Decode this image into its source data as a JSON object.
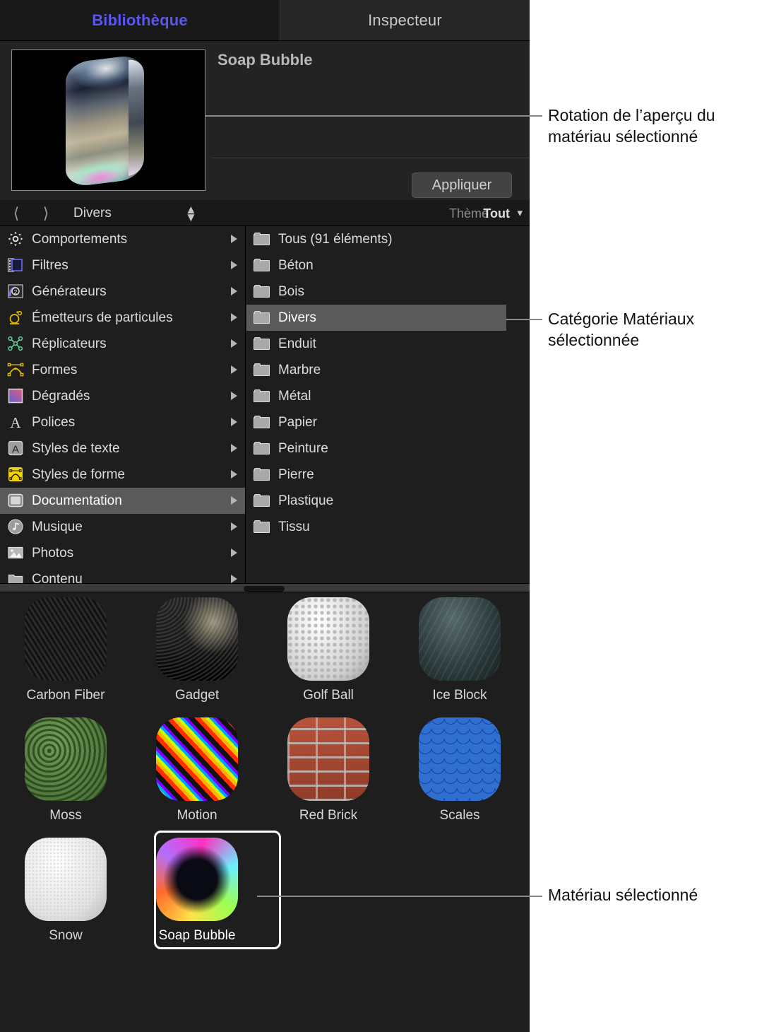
{
  "tabs": [
    {
      "label": "Bibliothèque",
      "active": true
    },
    {
      "label": "Inspecteur",
      "active": false
    }
  ],
  "preview": {
    "title": "Soap Bubble",
    "apply_label": "Appliquer"
  },
  "navbar": {
    "back_icon": "chevron-left-icon",
    "forward_icon": "chevron-right-icon",
    "path": "Divers",
    "sort_up": "▲",
    "sort_down": "▼",
    "theme_label": "Thème :",
    "theme_value": "Tout",
    "theme_caret": "⌄"
  },
  "sidebar": {
    "items": [
      {
        "label": "Comportements",
        "icon": "gear-icon",
        "selected": false
      },
      {
        "label": "Filtres",
        "icon": "filmstrip-icon",
        "selected": false
      },
      {
        "label": "Générateurs",
        "icon": "generator-icon",
        "selected": false
      },
      {
        "label": "Émetteurs de particules",
        "icon": "particle-emitter-icon",
        "selected": false
      },
      {
        "label": "Réplicateurs",
        "icon": "replicator-icon",
        "selected": false
      },
      {
        "label": "Formes",
        "icon": "shape-icon",
        "selected": false
      },
      {
        "label": "Dégradés",
        "icon": "gradient-icon",
        "selected": false
      },
      {
        "label": "Polices",
        "icon": "font-icon",
        "selected": false
      },
      {
        "label": "Styles de texte",
        "icon": "text-style-icon",
        "selected": false
      },
      {
        "label": "Styles de forme",
        "icon": "shape-style-icon",
        "selected": false
      },
      {
        "label": "Documentation",
        "icon": "documentation-icon",
        "selected": true
      },
      {
        "label": "Musique",
        "icon": "music-icon",
        "selected": false
      },
      {
        "label": "Photos",
        "icon": "photos-icon",
        "selected": false
      },
      {
        "label": "Contenu",
        "icon": "folder-icon",
        "selected": false
      }
    ]
  },
  "categories": {
    "items": [
      {
        "label": "Tous (91 éléments)",
        "selected": false
      },
      {
        "label": "Béton",
        "selected": false
      },
      {
        "label": "Bois",
        "selected": false
      },
      {
        "label": "Divers",
        "selected": true
      },
      {
        "label": "Enduit",
        "selected": false
      },
      {
        "label": "Marbre",
        "selected": false
      },
      {
        "label": "Métal",
        "selected": false
      },
      {
        "label": "Papier",
        "selected": false
      },
      {
        "label": "Peinture",
        "selected": false
      },
      {
        "label": "Pierre",
        "selected": false
      },
      {
        "label": "Plastique",
        "selected": false
      },
      {
        "label": "Tissu",
        "selected": false
      }
    ]
  },
  "grid": {
    "items": [
      {
        "label": "Carbon Fiber",
        "texture": "t-carbon",
        "selected": false
      },
      {
        "label": "Gadget",
        "texture": "t-gadget",
        "selected": false
      },
      {
        "label": "Golf Ball",
        "texture": "t-golf",
        "selected": false
      },
      {
        "label": "Ice Block",
        "texture": "t-ice",
        "selected": false
      },
      {
        "label": "Moss",
        "texture": "t-moss",
        "selected": false
      },
      {
        "label": "Motion",
        "texture": "t-motion",
        "selected": false
      },
      {
        "label": "Red Brick",
        "texture": "t-brick",
        "selected": false
      },
      {
        "label": "Scales",
        "texture": "t-scales",
        "selected": false
      },
      {
        "label": "Snow",
        "texture": "t-snow",
        "selected": false
      },
      {
        "label": "Soap Bubble",
        "texture": "t-soap",
        "selected": true
      }
    ]
  },
  "callouts": [
    {
      "text": "Rotation de l’aperçu du matériau sélectionné"
    },
    {
      "text": "Catégorie Matériaux sélectionnée"
    },
    {
      "text": "Matériau sélectionné"
    }
  ],
  "colors": {
    "accent": "#5b56f0",
    "panel_bg": "#1e1e1e",
    "selection": "#5a5a5a",
    "text": "#dcdcdc"
  }
}
